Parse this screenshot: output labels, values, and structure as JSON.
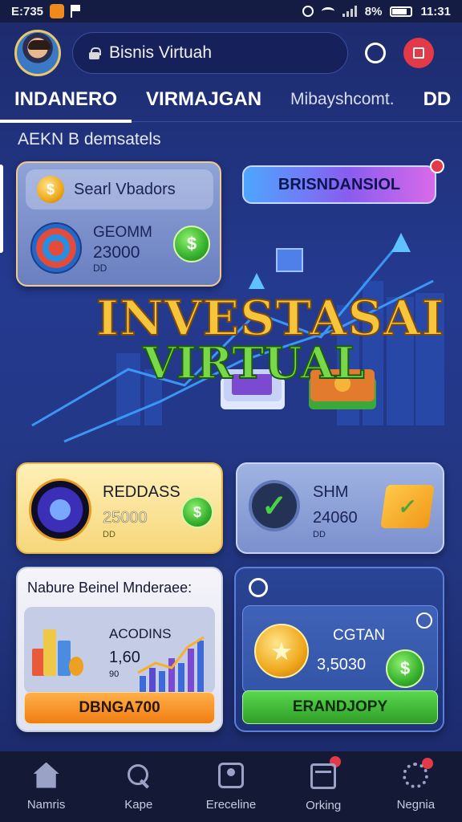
{
  "status_bar": {
    "time_left": "E:735",
    "battery": "8%",
    "time_right": "11:31"
  },
  "header": {
    "search_text": "Bisnis Virtuah",
    "icons": [
      "lock-icon",
      "ring-icon",
      "red-square-icon"
    ]
  },
  "tabs": [
    {
      "label": "INDANERO",
      "active": true
    },
    {
      "label": "VIRMAJGAN",
      "active": false
    },
    {
      "label": "Mibayshcomt.",
      "active": false
    },
    {
      "label": "DD",
      "active": false
    }
  ],
  "section_title": "AEKN B demsatels",
  "card_a": {
    "pill_label": "Searl Vbadors",
    "name": "GEOMM",
    "value": "23000",
    "sub": "DD"
  },
  "promo_button": {
    "label": "BRISNDANSIOL"
  },
  "hero": {
    "line1": "INVESTASAI",
    "line2": "VIRTUAL"
  },
  "card_b": {
    "name": "REDDASS",
    "value": "25000",
    "sub": "DD"
  },
  "card_c": {
    "name": "SHM",
    "value": "24060",
    "sub": "DD"
  },
  "card_d": {
    "heading": "Nabure Beinel Mnderaee:",
    "name": "ACODINS",
    "value": "1,60",
    "sub": "90",
    "cta": "DBNGA700"
  },
  "card_e": {
    "name": "CGTAN",
    "value": "3,5030",
    "cta": "ERANDJOPY"
  },
  "bottom_nav": [
    {
      "label": "Namris",
      "icon": "home-icon"
    },
    {
      "label": "Kape",
      "icon": "search-icon"
    },
    {
      "label": "Ereceline",
      "icon": "user-icon"
    },
    {
      "label": "Orking",
      "icon": "card-icon"
    },
    {
      "label": "Negnia",
      "icon": "gear-icon"
    }
  ],
  "colors": {
    "background": "#243a8f",
    "accent_gold": "#f7c53c",
    "accent_green": "#79d84a",
    "badge_red": "#e23a48"
  }
}
